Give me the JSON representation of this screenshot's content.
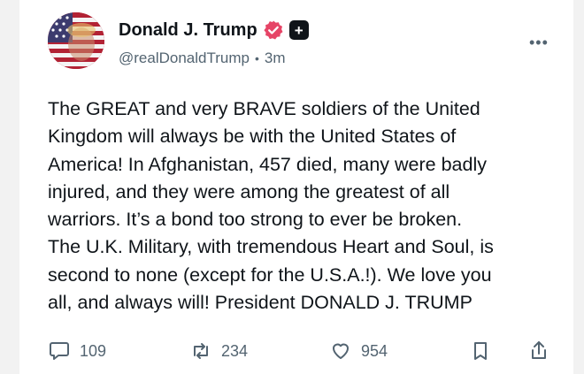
{
  "post": {
    "author": {
      "display_name": "Donald J. Trump",
      "handle": "@realDonaldTrump",
      "separator": "•",
      "time_ago": "3m",
      "badge_plus": "+"
    },
    "more_label": "•••",
    "lines": [
      "The GREAT and very BRAVE soldiers of the United",
      "Kingdom will always be with the United States of",
      "America! In Afghanistan, 457 died, many were badly",
      "injured, and they were among the greatest of all",
      "warriors. It’s a bond too strong to ever be broken.",
      "The U.K. Military, with tremendous Heart and Soul, is",
      "second to none (except for the U.S.A.!). We love you",
      "all, and always will! President DONALD J. TRUMP"
    ],
    "actions": {
      "replies": "109",
      "retruths": "234",
      "likes": "954"
    }
  },
  "icons": {
    "verified": "verified-badge-icon",
    "reply": "comment-icon",
    "retruth": "retruth-icon",
    "like": "heart-icon",
    "bookmark": "bookmark-icon",
    "share": "share-icon"
  },
  "colors": {
    "verified": "#e64466",
    "text": "#0f1419",
    "muted": "#536471"
  }
}
